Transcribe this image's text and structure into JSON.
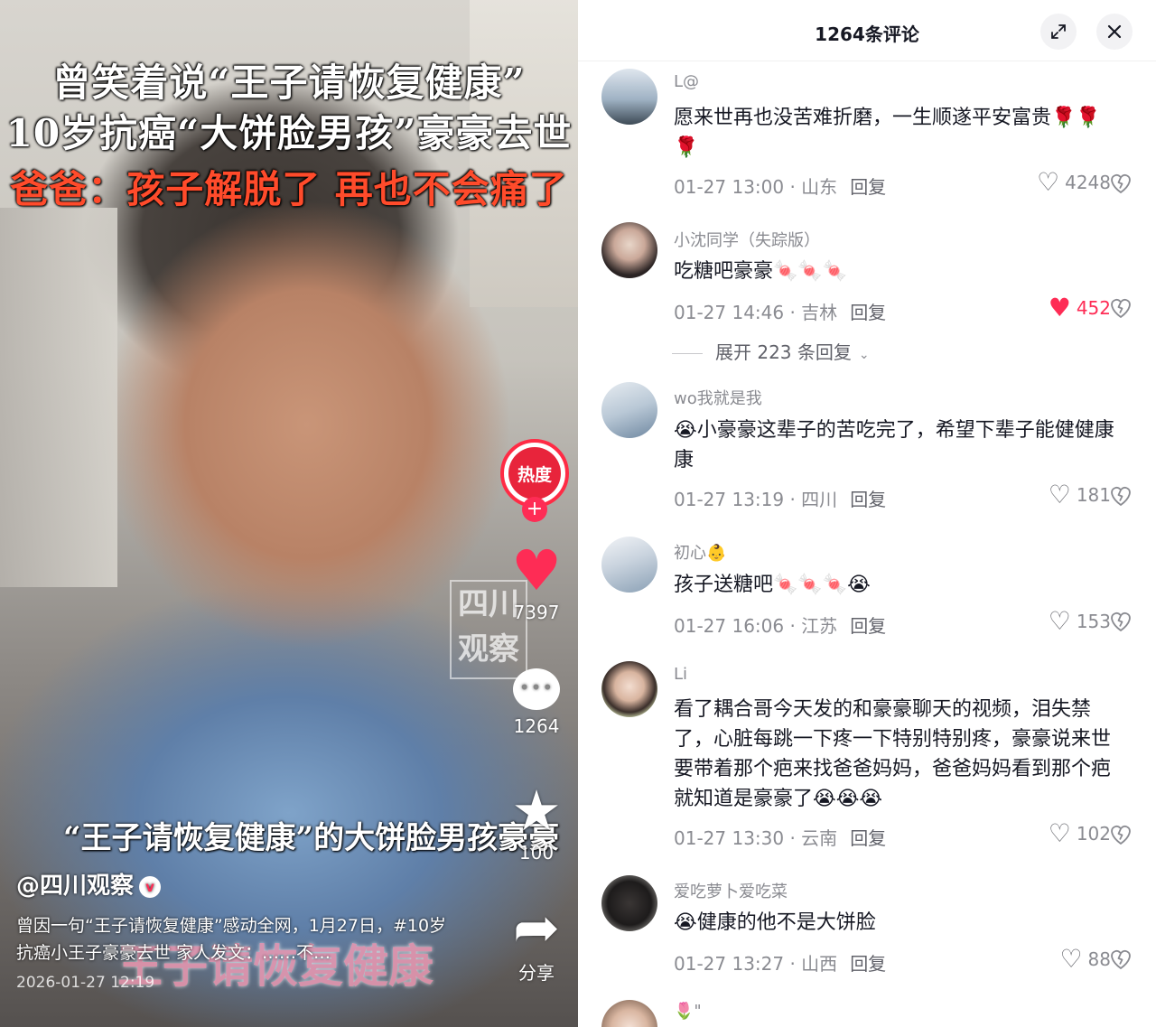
{
  "video": {
    "headline_1": "曾笑着说“王子请恢复健康”",
    "headline_2": "10岁抗癌“大饼脸男孩”豪豪去世",
    "headline_3": "爸爸：孩子解脱了 再也不会痛了",
    "caption_bottom": "“王子请恢复健康”的大饼脸男孩豪豪",
    "watermark": "四川观察",
    "overlay_caption": "王子请恢复健康",
    "hot_badge": "热度",
    "likes": "7397",
    "comments": "1264",
    "favorites": "100",
    "share_label": "分享",
    "author": "@四川观察",
    "description": "曾因一句“王子请恢复健康”感动全网，1月27日，#10岁抗癌小王子豪豪去世 家人发文：……不…",
    "date": "2026-01-27 12:19"
  },
  "comments_panel": {
    "title": "1264条评论",
    "expand_icon": "expand-arrows-icon",
    "close_icon": "close-icon",
    "expand_replies_label": "展开 223 条回复",
    "reply_label": "回复",
    "comments": [
      {
        "user": "L@",
        "text": "愿来世再也没苦难折磨，一生顺遂平安富贵🌹🌹🌹",
        "meta": "01-27 13:00 · 山东",
        "likes": "4248",
        "liked": false
      },
      {
        "user": "小沈同学（失踪版）",
        "text": "吃糖吧豪豪🍬🍬🍬",
        "meta": "01-27 14:46 · 吉林",
        "likes": "452",
        "liked": true
      },
      {
        "user": "wo我就是我",
        "text": "😭小豪豪这辈子的苦吃完了，希望下辈子能健健康康",
        "meta": "01-27 13:19 · 四川",
        "likes": "181",
        "liked": false
      },
      {
        "user": "初心👶",
        "text": "孩子送糖吧🍬🍬🍬😭",
        "meta": "01-27 16:06 · 江苏",
        "likes": "153",
        "liked": false
      },
      {
        "user": "Li",
        "text": "看了耦合哥今天发的和豪豪聊天的视频，泪失禁了，心脏每跳一下疼一下特别特别疼，豪豪说来世要带着那个疤来找爸爸妈妈，爸爸妈妈看到那个疤就知道是豪豪了😭😭😭",
        "meta": "01-27 13:30 · 云南",
        "likes": "102",
        "liked": false
      },
      {
        "user": "爱吃萝卜爱吃菜",
        "text": "😭健康的他不是大饼脸",
        "meta": "01-27 13:27 · 山西",
        "likes": "88",
        "liked": false
      },
      {
        "user": "🌷\"",
        "text": "",
        "meta": "",
        "likes": "",
        "liked": false
      }
    ]
  },
  "colors": {
    "accent": "#fe2c55",
    "meta_gray": "#8a8b91",
    "text": "#161823"
  }
}
